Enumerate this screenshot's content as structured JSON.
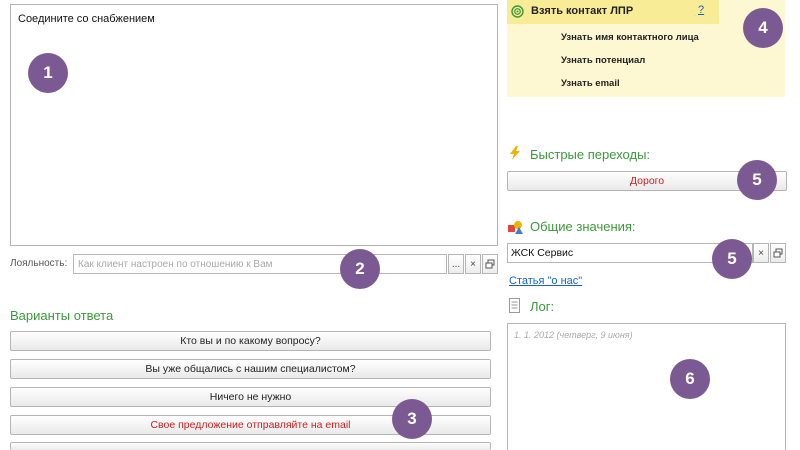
{
  "script": {
    "text": "Соедините со снабжением"
  },
  "loyalty": {
    "label": "Лояльность:",
    "placeholder": "Как клиент настроен по отношению к Вам",
    "dots_label": "...",
    "clear_label": "×"
  },
  "answers": {
    "title": "Варианты ответа",
    "items": [
      {
        "label": "Кто вы и по какому вопросу?"
      },
      {
        "label": "Вы уже общались с нашим специалистом?"
      },
      {
        "label": "Ничего не нужно"
      },
      {
        "label": "Свое предложение отправляйте на email"
      }
    ]
  },
  "task": {
    "title": "Взять контакт ЛПР",
    "help": "?",
    "items": [
      {
        "label": "Узнать имя контактного лица"
      },
      {
        "label": "Узнать потенциал"
      },
      {
        "label": "Узнать email"
      }
    ]
  },
  "quick": {
    "title": "Быстрые переходы:",
    "button": "Дорого"
  },
  "common": {
    "title": "Общие значения:",
    "value": "ЖСК Сервис",
    "clear_label": "×",
    "link": "Статья \"о нас\""
  },
  "log": {
    "title": "Лог:",
    "entry": "1. 1.  2012 (четверг, 9 июня)"
  },
  "markers": [
    "1",
    "2",
    "3",
    "4",
    "5",
    "5",
    "6"
  ],
  "colors": {
    "section_title": "#3a9a3a",
    "accent_red": "#cc1c1c",
    "link": "#1565c0",
    "marker": "#7b5a93",
    "task_bg": "#fdf8d2",
    "task_header_bg": "#f8ec96"
  }
}
